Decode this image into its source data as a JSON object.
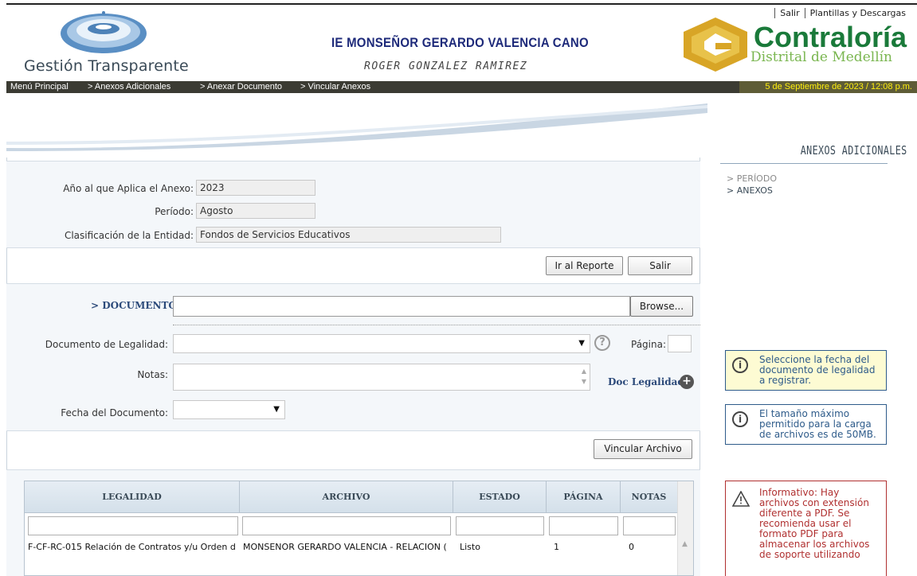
{
  "top_links": {
    "salir": "Salir",
    "plantillas": "Plantillas y Descargas"
  },
  "brand": {
    "name": "Gestión Transparente"
  },
  "institution": {
    "title": "IE MONSEÑOR GERARDO VALENCIA CANO",
    "user": "ROGER GONZALEZ RAMIREZ"
  },
  "contraloria": {
    "name": "Contraloría",
    "subtitle": "Distrital de Medellín"
  },
  "breadcrumb": {
    "items": [
      "Menú Principal",
      "> Anexos Adicionales",
      "> Anexar Documento",
      "> Vincular Anexos"
    ],
    "datetime": "5 de Septiembre de 2023 / 12:08 p.m."
  },
  "panel_title": "ANEXOS ADICIONALES",
  "form": {
    "anio_label": "Año al que Aplica el Anexo:",
    "anio_value": "2023",
    "periodo_label": "Período:",
    "periodo_value": "Agosto",
    "clasif_label": "Clasificación de la Entidad:",
    "clasif_value": "Fondos de Servicios Educativos",
    "ir_reporte": "Ir al Reporte",
    "salir": "Salir",
    "documento_label": "> DOCUMENTO",
    "browse": "Browse...",
    "doc_legalidad_label": "Documento de Legalidad:",
    "doc_legalidad_value": "",
    "help_glyph": "?",
    "pagina_label": "Página:",
    "notas_label": "Notas:",
    "doc_legalidad_link": "Doc Legalidad",
    "fecha_label": "Fecha del Documento:",
    "fecha_value": "",
    "vincular": "Vincular Archivo"
  },
  "grid": {
    "headers": [
      "LEGALIDAD",
      "ARCHIVO",
      "ESTADO",
      "PÁGINA",
      "NOTAS"
    ],
    "rows": [
      [
        "F-CF-RC-015 Relación de Contratos y/u Orden d",
        "MONSENOR GERARDO VALENCIA - RELACION (",
        "Listo",
        "1",
        "0"
      ]
    ]
  },
  "sidebar": {
    "links": [
      "> PERÍODO",
      "> ANEXOS"
    ],
    "info1": [
      "Seleccione la fecha del",
      "documento de legalidad",
      "a registrar."
    ],
    "info2": [
      "El tamaño máximo",
      "permitido para la carga",
      "de archivos es de 50MB."
    ],
    "warning": [
      "Informativo: Hay",
      "archivos con extensión",
      "diferente a PDF. Se",
      "recomienda usar el",
      "formato PDF para",
      "almacenar los archivos",
      "de soporte utilizando"
    ]
  },
  "colors": {
    "nav_bg": "#3b3b33",
    "date_text": "#ffee00",
    "brand_green": "#1a7a3a",
    "title_blue": "#1e2a7a",
    "warn_red": "#b03030",
    "info_blue": "#2e5b8a"
  }
}
